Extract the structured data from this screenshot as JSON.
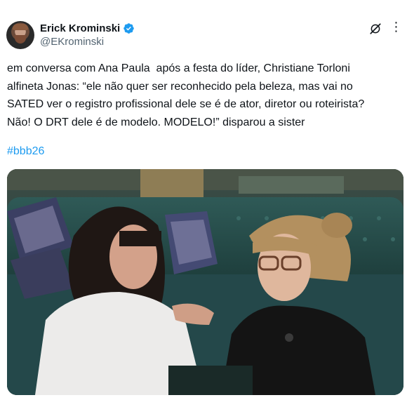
{
  "author": {
    "display_name": "Erick Krominski",
    "handle": "@EKrominski",
    "avatar_icon": "avatar",
    "verified_icon": "verified-badge-icon",
    "verified_color": "#1d9bf0"
  },
  "actions": {
    "grok_icon": "grok-icon",
    "more_icon": "more-icon"
  },
  "tweet": {
    "text": "em conversa com Ana Paula  após a festa do líder, Christiane Torloni\nalfineta Jonas: “ele não quer ser reconhecido pela beleza, mas vai no\nSATED ver o registro profissional dele se é de ator, diretor ou roteirista?\nNão! O DRT dele é de modelo. MODELO!” disparou a sister",
    "hashtag": "#bbb26",
    "hashtag_color": "#1d9bf0"
  },
  "media": {
    "type": "photo"
  }
}
